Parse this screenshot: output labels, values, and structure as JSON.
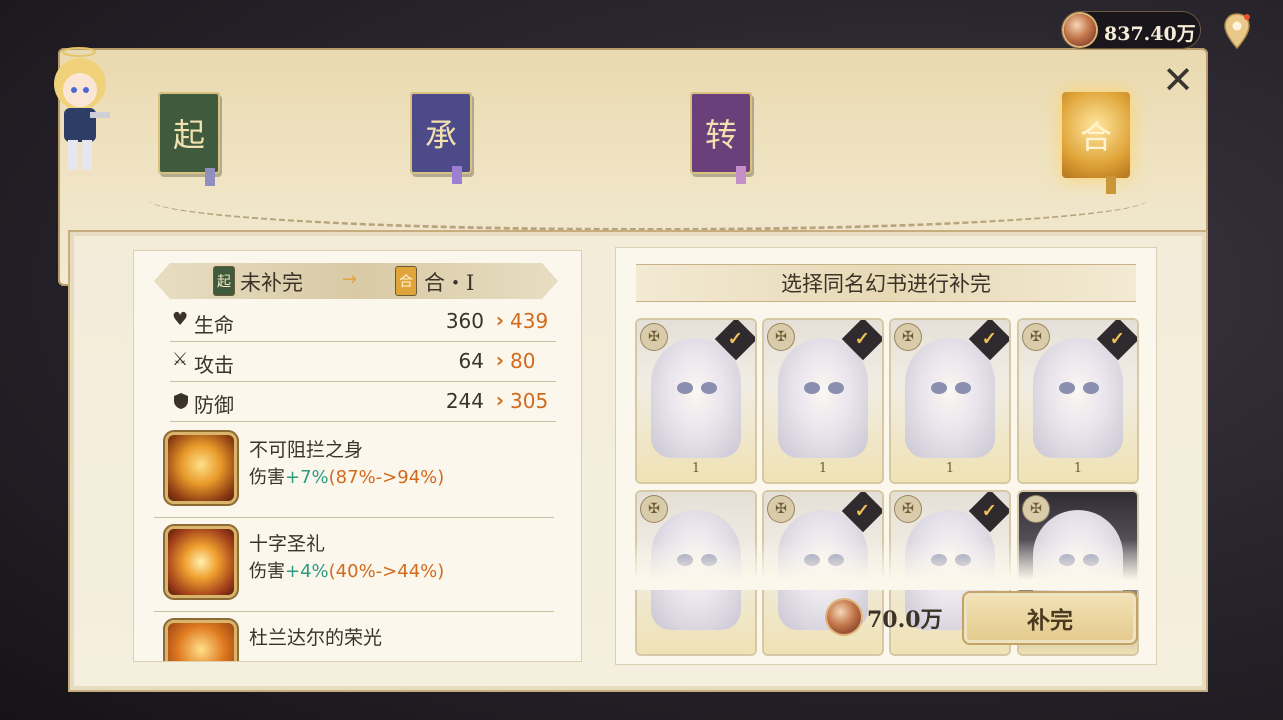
{
  "currency": {
    "amount": "837.40万",
    "icon": "coin-icon"
  },
  "stages": [
    {
      "label": "起",
      "color": "#3f5a3c",
      "ribbon": "#8f8fc0"
    },
    {
      "label": "承",
      "color": "#4d4a8a",
      "ribbon": "#9b7fd0"
    },
    {
      "label": "转",
      "color": "#6b3f7a",
      "ribbon": "#c58fc7"
    },
    {
      "label": "合",
      "color": "#e0a53a",
      "ribbon": "#c9973a"
    }
  ],
  "left_panel": {
    "from_label": "未补完",
    "from_book": "起",
    "to_label": "合・Ⅰ",
    "to_book": "合",
    "stats": [
      {
        "name": "生命",
        "icon": "heart-icon",
        "old": "360",
        "new": "439"
      },
      {
        "name": "攻击",
        "icon": "sword-icon",
        "old": "64",
        "new": "80"
      },
      {
        "name": "防御",
        "icon": "shield-icon",
        "old": "244",
        "new": "305"
      }
    ],
    "skills": [
      {
        "name": "不可阻拦之身",
        "prefix": "伤害",
        "gain": "+7%",
        "range": "(87%->94%)"
      },
      {
        "name": "十字圣礼",
        "prefix": "伤害",
        "gain": "+4%",
        "range": "(40%->44%)"
      },
      {
        "name": "杜兰达尔的荣光",
        "prefix": "",
        "gain": "",
        "range": ""
      }
    ]
  },
  "right_panel": {
    "title": "选择同名幻书进行补完",
    "cards": [
      {
        "level": "1",
        "checked": true
      },
      {
        "level": "1",
        "checked": true
      },
      {
        "level": "1",
        "checked": true
      },
      {
        "level": "1",
        "checked": true
      },
      {
        "level": "",
        "checked": true
      },
      {
        "level": "",
        "checked": true
      },
      {
        "level": "",
        "checked": true
      },
      {
        "level": "",
        "checked": false
      }
    ],
    "cost": "70.0万",
    "confirm_label": "补完"
  },
  "colors": {
    "accent": "#d26a1e",
    "gain": "#2f9a82",
    "text": "#3b3328"
  }
}
